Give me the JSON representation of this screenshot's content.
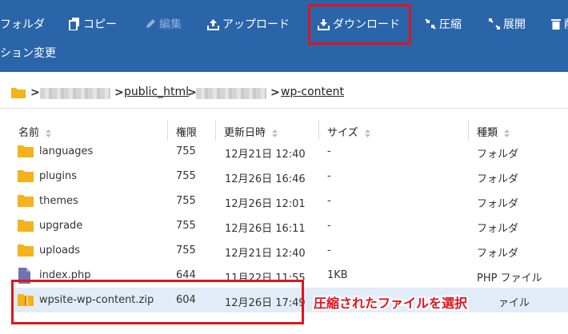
{
  "toolbar": {
    "folder_label": "フォルダ",
    "copy_label": "コピー",
    "edit_label": "編集",
    "upload_label": "アップロード",
    "download_label": "ダウンロード",
    "compress_label": "圧縮",
    "extract_label": "展開",
    "delete_label": "削",
    "permission_label": "ション変更"
  },
  "breadcrumb": {
    "items": [
      "public_html",
      "wp-content"
    ]
  },
  "table": {
    "headers": {
      "name": "名前",
      "permission": "権限",
      "modified": "更新日時",
      "size": "サイズ",
      "type": "種類"
    },
    "rows": [
      {
        "name": "languages",
        "perm": "755",
        "date": "12月21日 12:40",
        "size": "-",
        "type": "フォルダ",
        "icon": "folder-icon"
      },
      {
        "name": "plugins",
        "perm": "755",
        "date": "12月26日 16:46",
        "size": "-",
        "type": "フォルダ",
        "icon": "folder-icon"
      },
      {
        "name": "themes",
        "perm": "755",
        "date": "12月26日 12:01",
        "size": "-",
        "type": "フォルダ",
        "icon": "folder-icon"
      },
      {
        "name": "upgrade",
        "perm": "755",
        "date": "12月26日 16:11",
        "size": "-",
        "type": "フォルダ",
        "icon": "folder-icon"
      },
      {
        "name": "uploads",
        "perm": "755",
        "date": "12月21日 12:40",
        "size": "-",
        "type": "フォルダ",
        "icon": "folder-icon"
      },
      {
        "name": "index.php",
        "perm": "644",
        "date": "11月22日 11:55",
        "size": "1KB",
        "type": "PHP ファイル",
        "icon": "php-file-icon"
      },
      {
        "name": "wpsite-wp-content.zip",
        "perm": "604",
        "date": "12月26日 17:49",
        "size": "",
        "type": "ァイル",
        "icon": "zip-file-icon",
        "selected": true
      }
    ]
  },
  "annotation": "圧縮されたファイルを選択",
  "colors": {
    "toolbar_bg": "#2a65aa",
    "highlight": "#e0141e",
    "folder": "#f5b21b",
    "selected_row": "#e2ecf8"
  }
}
